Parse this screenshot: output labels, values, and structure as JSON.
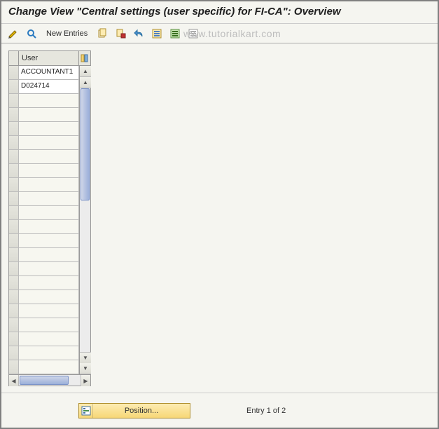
{
  "title": "Change View \"Central settings (user specific) for FI-CA\": Overview",
  "toolbar": {
    "new_entries_label": "New Entries"
  },
  "watermark": "www.tutorialkart.com",
  "table": {
    "header_user": "User",
    "rows": [
      {
        "user": "ACCOUNTANT1"
      },
      {
        "user": "D024714"
      },
      {
        "user": ""
      },
      {
        "user": ""
      },
      {
        "user": ""
      },
      {
        "user": ""
      },
      {
        "user": ""
      },
      {
        "user": ""
      },
      {
        "user": ""
      },
      {
        "user": ""
      },
      {
        "user": ""
      },
      {
        "user": ""
      },
      {
        "user": ""
      },
      {
        "user": ""
      },
      {
        "user": ""
      },
      {
        "user": ""
      },
      {
        "user": ""
      },
      {
        "user": ""
      },
      {
        "user": ""
      },
      {
        "user": ""
      },
      {
        "user": ""
      },
      {
        "user": ""
      }
    ]
  },
  "footer": {
    "position_label": "Position...",
    "entry_text": "Entry 1 of 2"
  }
}
